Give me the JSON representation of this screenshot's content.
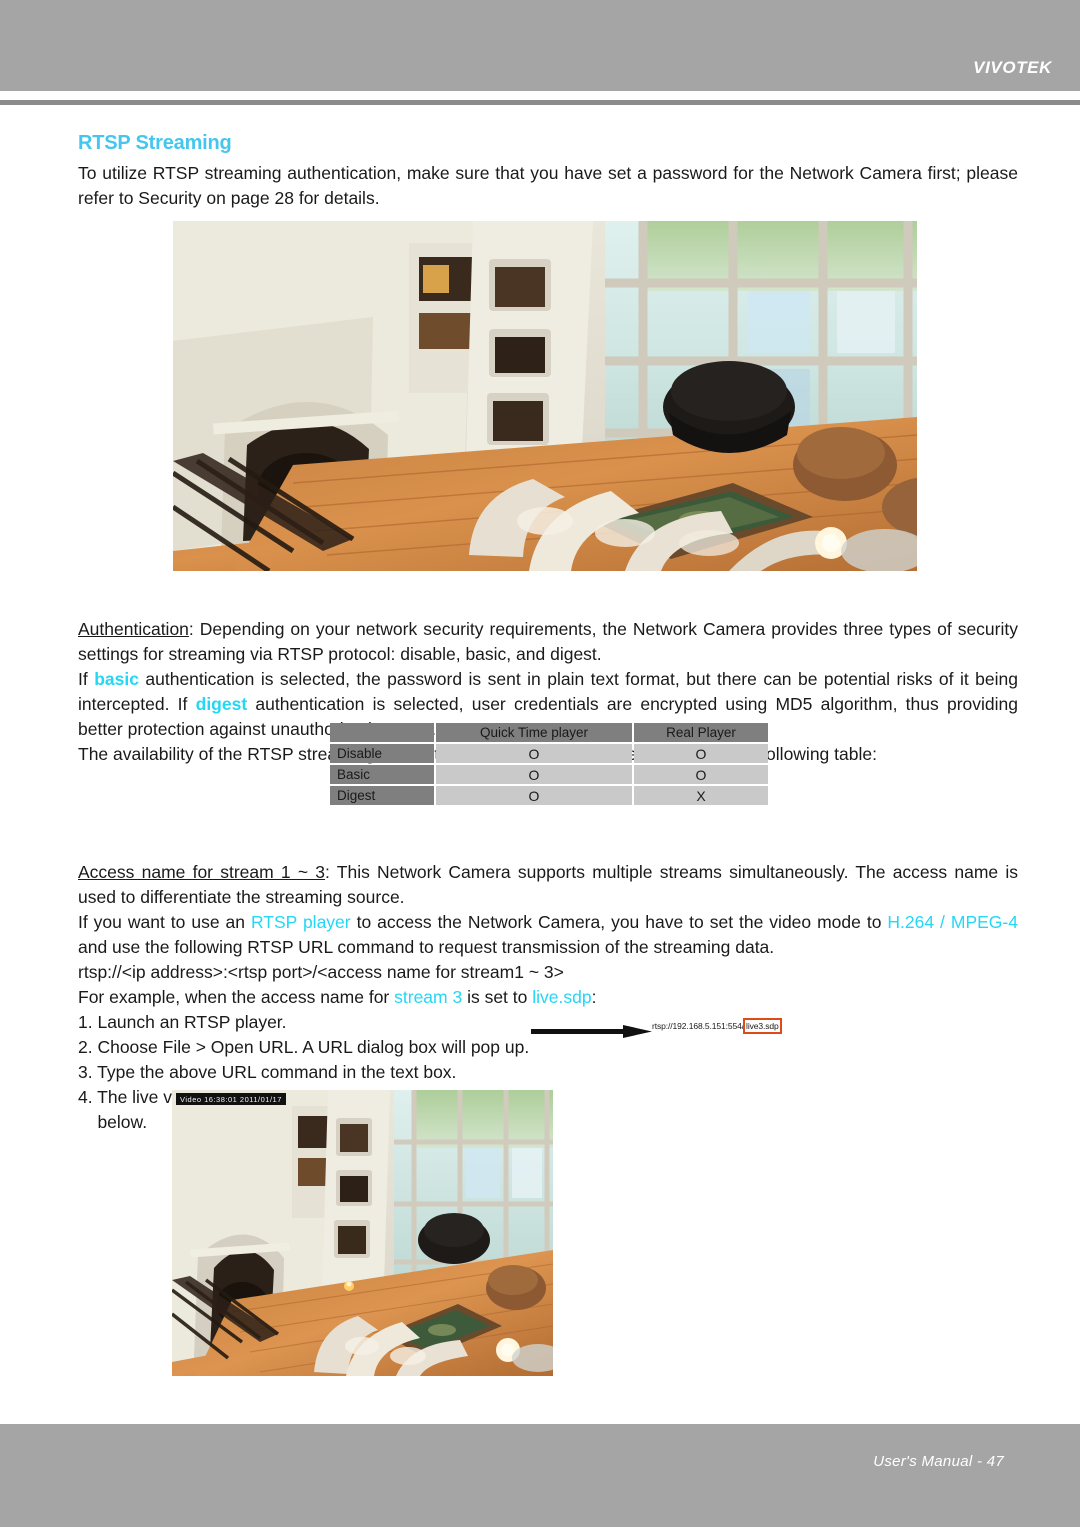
{
  "header": {
    "logo": "VIVOTEK"
  },
  "section": {
    "title": "RTSP Streaming",
    "intro": "To utilize RTSP streaming authentication, make sure that you have set a password for the Network Camera first; please refer to Security on page 28 for details."
  },
  "top_image": {
    "alt": "Living room surveillance camera view with fireplace, sofa and windows"
  },
  "authentication": {
    "label": "Authentication",
    "line1_rest": ": Depending on your network security requirements, the Network Camera provides three types of security settings for streaming via RTSP protocol: disable, basic, and digest.",
    "p2_a": "If ",
    "p2_basic": "basic",
    "p2_b": " authentication is selected, the password is sent in plain text format, but there can be potential risks of it being intercepted. If ",
    "p2_digest": "digest",
    "p2_c": " authentication is selected, user credentials are encrypted using MD5 algorithm, thus providing better protection against unauthorized access.",
    "p3": "The availability of the RTSP streaming for the three authentication modes is listed in the following table:"
  },
  "availability_table": {
    "corner": "",
    "columns": [
      "Quick Time player",
      "Real Player"
    ],
    "rows": [
      {
        "label": "Disable",
        "values": [
          "O",
          "O"
        ]
      },
      {
        "label": "Basic",
        "values": [
          "O",
          "O"
        ]
      },
      {
        "label": "Digest",
        "values": [
          "O",
          "X"
        ]
      }
    ]
  },
  "access_name": {
    "label": "Access name for stream 1 ~ 3",
    "line1_rest": ": This Network Camera supports multiple streams simultaneously. The access name is used to differentiate the streaming source.",
    "p2_a": "If you want to use an ",
    "p2_rtsp_player": "RTSP player",
    "p2_b": " to access the Network Camera, you have to set the video mode to ",
    "p2_codec": "H.264 / MPEG-4",
    "p2_c": " and use the following RTSP URL command to request transmission of the streaming data.",
    "url_template": "rtsp://<ip address>:<rtsp port>/<access name for stream1 ~ 3>"
  },
  "example": {
    "lead_a": "For example, when the access name for ",
    "lead_stream": "stream 3",
    "lead_b": " is set to ",
    "lead_value": "live.sdp",
    "lead_c": ":",
    "steps": [
      "1. Launch an RTSP player.",
      "2. Choose File > Open URL. A URL dialog box will pop up.",
      "3. Type the above URL command in the text box.",
      "4. The live video will be displayed in your player as shown",
      "    below."
    ],
    "callout_url_prefix": "rtsp://192.168.5.151:554/",
    "callout_url_highlight": "live3.sdp"
  },
  "bottom_image": {
    "timestamp": "Video 16:38:01 2011/01/17",
    "alt": "Live video preview in RTSP player showing the same living room"
  },
  "footer": {
    "text": "User's Manual - 47"
  },
  "colors": {
    "accent": "#23d7f5",
    "heading": "#44c6ef",
    "band": "#a5a5a5",
    "table_head": "#7f7f7f",
    "table_cell": "#c9c9c9",
    "callout_box": "#e04a18"
  }
}
